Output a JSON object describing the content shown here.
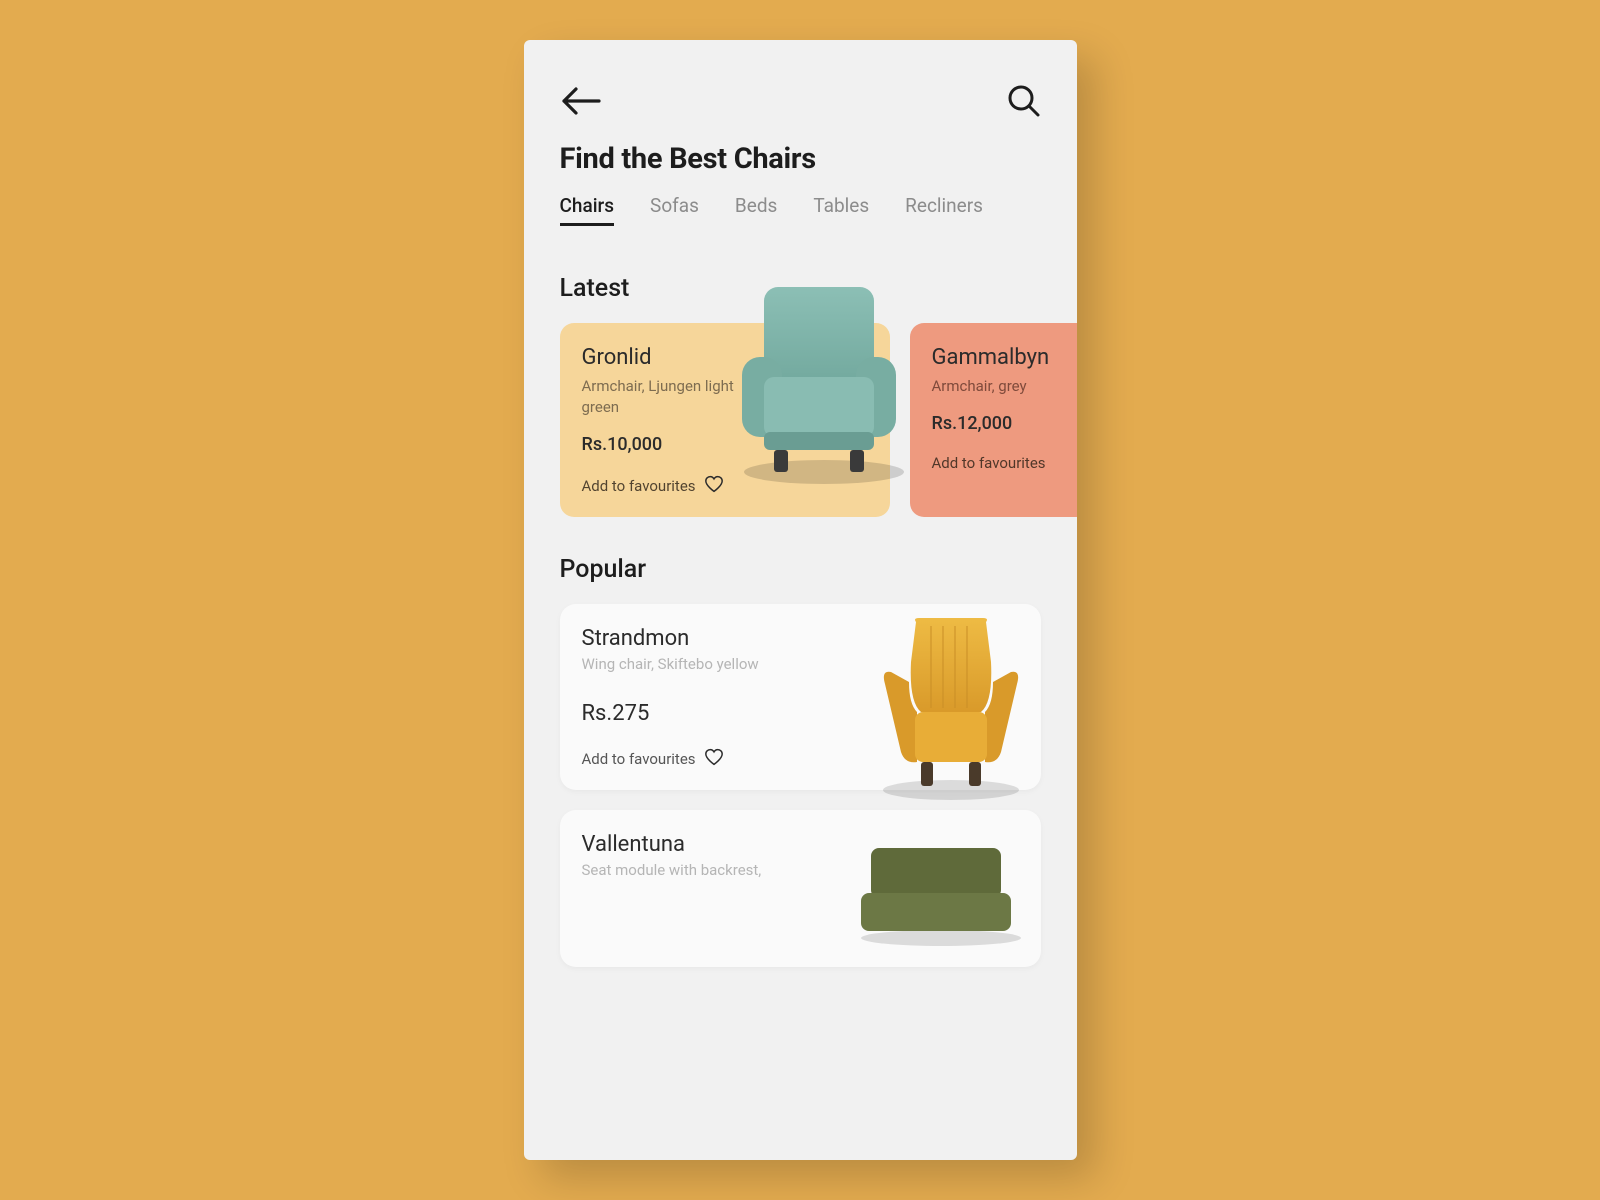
{
  "header": {
    "back_icon": "arrow-left",
    "search_icon": "search"
  },
  "title": "Find the Best Chairs",
  "tabs": [
    "Chairs",
    "Sofas",
    "Beds",
    "Tables",
    "Recliners"
  ],
  "active_tab": 0,
  "sections": {
    "latest_label": "Latest",
    "popular_label": "Popular"
  },
  "latest": [
    {
      "name": "Gronlid",
      "desc": "Armchair, Ljungen light green",
      "price": "Rs.10,000",
      "fav_label": "Add to favourites",
      "card_color": "#f6d69a",
      "chair_color": "#7fb2a8"
    },
    {
      "name": "Gammalbyn",
      "desc": "Armchair, grey",
      "price": "Rs.12,000",
      "fav_label": "Add to favourites",
      "card_color": "#ee9a7f"
    }
  ],
  "popular": [
    {
      "name": "Strandmon",
      "desc": "Wing chair, Skiftebo yellow",
      "price": "Rs.275",
      "fav_label": "Add to favourites",
      "chair_color": "#e2a92e"
    },
    {
      "name": "Vallentuna",
      "desc": "Seat module with backrest,",
      "chair_color": "#5f6a3a"
    }
  ]
}
